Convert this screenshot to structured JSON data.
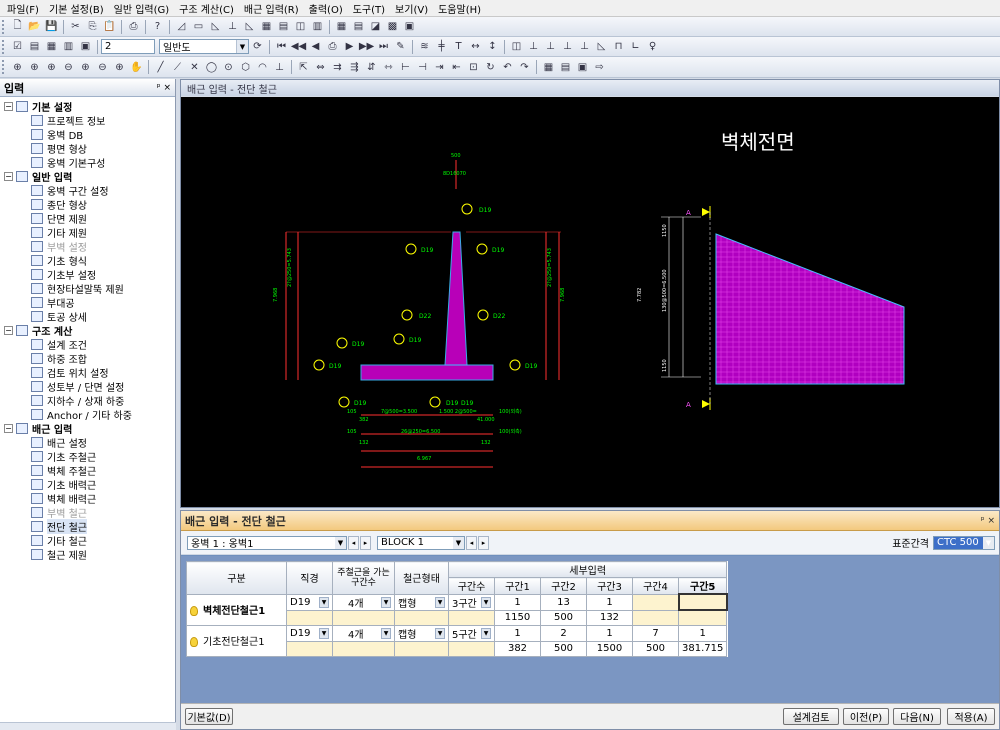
{
  "menu": [
    "파일(F)",
    "기본 설정(B)",
    "일반 입력(G)",
    "구조 계산(C)",
    "배근 입력(R)",
    "출력(O)",
    "도구(T)",
    "보기(V)",
    "도움말(H)"
  ],
  "toolbar": {
    "layer_value": "2",
    "style_value": "일반도"
  },
  "left_panel": {
    "title": "입력",
    "pin": "ᵖ ×",
    "categories": [
      {
        "label": "기본 설정",
        "items": [
          "프로젝트 정보",
          "옹벽 DB",
          "평면 형상",
          "옹벽 기본구성"
        ]
      },
      {
        "label": "일반 입력",
        "items": [
          "옹벽 구간 설정",
          "종단 형상",
          "단면 제원",
          "기타 제원",
          "부벽 설정",
          "기초 형식",
          "기초부 설정",
          "현장타설말뚝 제원",
          "부대공",
          "토공 상세"
        ]
      },
      {
        "label": "구조 계산",
        "items": [
          "설계 조건",
          "하중 조합",
          "검토 위치 설정",
          "성토부 / 단면 설정",
          "지하수 / 상재 하중",
          "Anchor / 기타 하중"
        ]
      },
      {
        "label": "배근 입력",
        "items": [
          "배근 설정",
          "기초 주철근",
          "벽체 주철근",
          "기초 배력근",
          "벽체 배력근",
          "부벽 철근",
          "전단 철근",
          "기타 철근",
          "철근 제원"
        ]
      }
    ]
  },
  "drawing": {
    "window_title": "배근 입력 - 전단 철근",
    "view_title": "벽체전면",
    "section_label": "A"
  },
  "bottom_panel": {
    "title": "배근 입력 - 전단 철근",
    "wall_select": "옹벽 1 : 옹벽1",
    "block_select": "BLOCK  1",
    "spacing_label": "표준간격",
    "spacing_value": "CTC 500",
    "headers": {
      "gubun": "구분",
      "dia": "직경",
      "count": "주철근을 가는 구간수",
      "shape": "철근형태",
      "detail": "세부입력",
      "sections": "구간수",
      "s1": "구간1",
      "s2": "구간2",
      "s3": "구간3",
      "s4": "구간4",
      "s5": "구간5"
    },
    "rows": [
      {
        "name": "벽체전단철근1",
        "dia": "D19",
        "count": "4개",
        "shape": "캡형",
        "sections": "3구간",
        "r1": [
          "1",
          "13",
          "1",
          "",
          ""
        ],
        "r2": [
          "1150",
          "500",
          "132",
          "",
          ""
        ]
      },
      {
        "name": "기초전단철근1",
        "dia": "D19",
        "count": "4개",
        "shape": "캡형",
        "sections": "5구간",
        "r1": [
          "1",
          "2",
          "1",
          "7",
          "1"
        ],
        "r2": [
          "382",
          "500",
          "1500",
          "500",
          "381.715"
        ]
      }
    ],
    "buttons": {
      "default": "기본값(D)",
      "check": "설계검토",
      "prev": "이전(P)",
      "next": "다음(N)",
      "apply": "적용(A)"
    }
  }
}
